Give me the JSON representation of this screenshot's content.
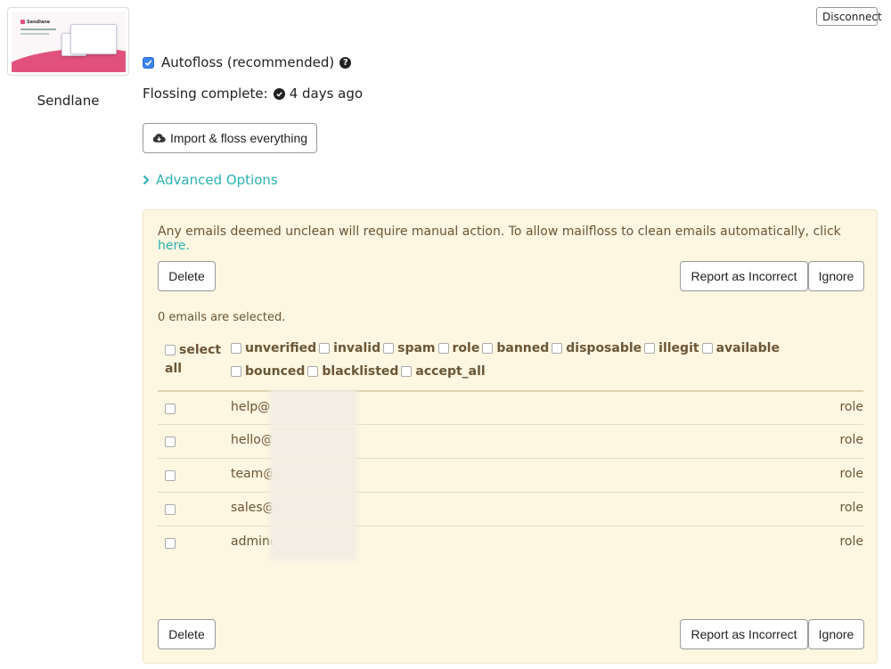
{
  "integration": {
    "name": "Sendlane",
    "thumbnail_logo_text": "Sendlane"
  },
  "header": {
    "disconnect_label": "Disconnect"
  },
  "autofloss": {
    "label": "Autofloss (recommended)",
    "checked": true
  },
  "status": {
    "label": "Flossing complete:",
    "value": "4 days ago"
  },
  "import_button_label": "Import & floss everything",
  "advanced_options_label": "Advanced Options",
  "panel": {
    "notice_text": "Any emails deemed unclean will require manual action. To allow mailfloss to clean emails automatically, click ",
    "notice_link": "here.",
    "delete_label": "Delete",
    "report_label": "Report as Incorrect",
    "ignore_label": "Ignore",
    "selected_count_text": "0 emails are selected.",
    "select_all_label": "select all",
    "filters": [
      "unverified",
      "invalid",
      "spam",
      "role",
      "banned",
      "disposable",
      "illegit",
      "available",
      "bounced",
      "blacklisted",
      "accept_all"
    ],
    "rows": [
      {
        "email": "help@",
        "tag": "role"
      },
      {
        "email": "hello@",
        "tag": "role"
      },
      {
        "email": "team@",
        "tag": "role"
      },
      {
        "email": "sales@",
        "tag": "role"
      },
      {
        "email": "admin@",
        "tag": "role"
      }
    ]
  },
  "colors": {
    "accent": "#2bb3b3",
    "panel_bg": "#fdf6e1",
    "panel_text": "#6b5636",
    "checkbox_checked": "#3b82f6",
    "thumbnail_pink": "#e2517e"
  }
}
